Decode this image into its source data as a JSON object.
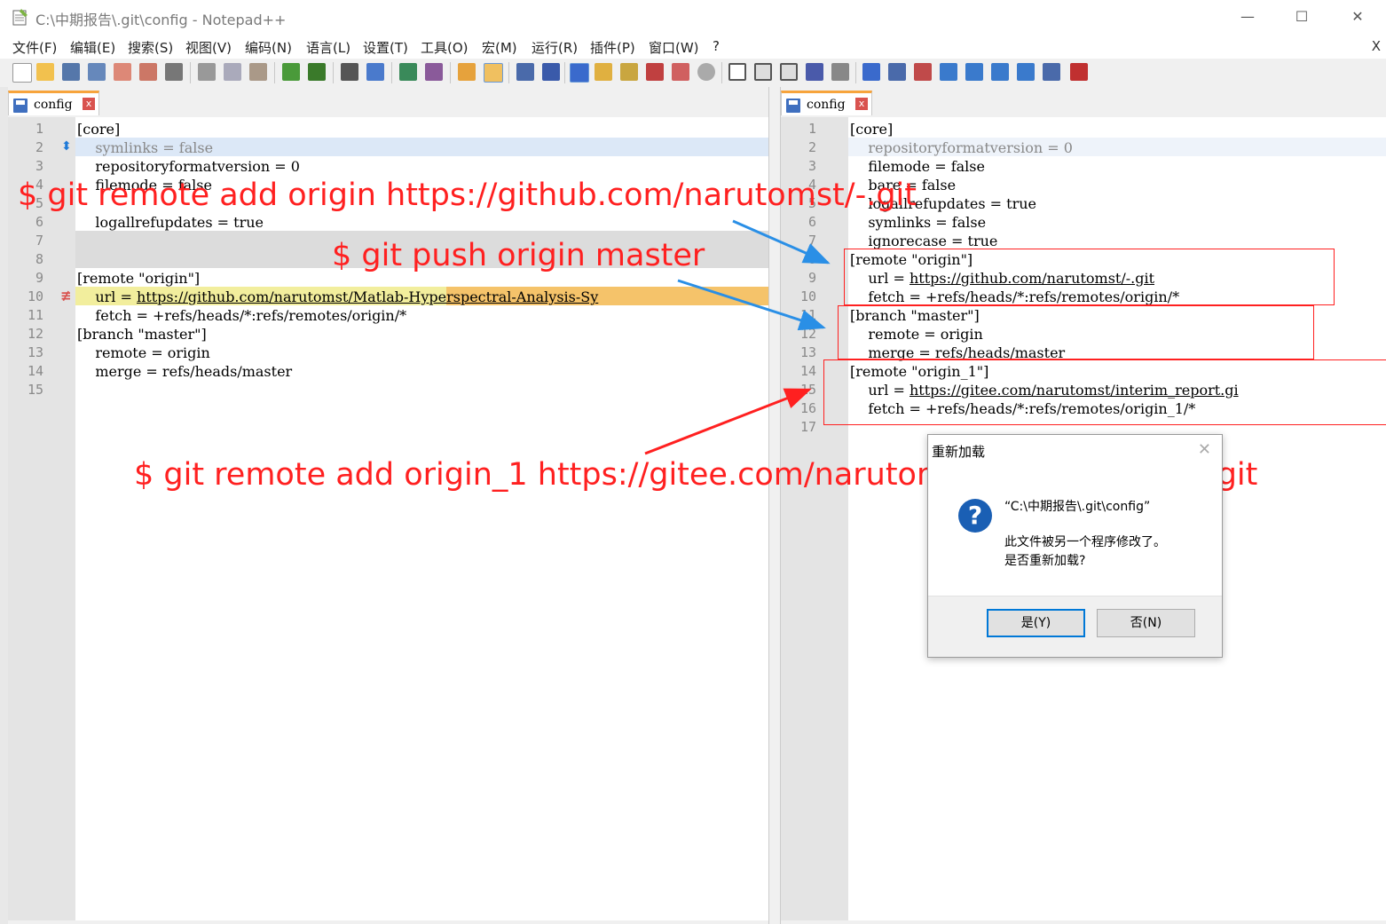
{
  "window": {
    "title": "C:\\中期报告\\.git\\config - Notepad++",
    "minimize": "—",
    "maximize": "☐",
    "close": "✕"
  },
  "menu": [
    "文件(F)",
    "编辑(E)",
    "搜索(S)",
    "视图(V)",
    "编码(N)",
    "语言(L)",
    "设置(T)",
    "工具(O)",
    "宏(M)",
    "运行(R)",
    "插件(P)",
    "窗口(W)",
    "?"
  ],
  "menu_close": "X",
  "left_tab": {
    "label": "config",
    "close": "x"
  },
  "right_tab": {
    "label": "config",
    "close": "x"
  },
  "left_lines": [
    {
      "n": "1",
      "text": "[core]"
    },
    {
      "n": "2",
      "text": "    symlinks = false"
    },
    {
      "n": "3",
      "text": "    repositoryformatversion = 0"
    },
    {
      "n": "4",
      "text": "    filemode = false"
    },
    {
      "n": "5",
      "text": ""
    },
    {
      "n": "6",
      "text": "    logallrefupdates = true"
    },
    {
      "n": "7",
      "text": ""
    },
    {
      "n": "8",
      "text": ""
    },
    {
      "n": "9",
      "text": "[remote \"origin\"]"
    },
    {
      "n": "10",
      "text": "    url = "
    },
    {
      "n": "11",
      "text": "    fetch = +refs/heads/*:refs/remotes/origin/*"
    },
    {
      "n": "12",
      "text": "[branch \"master\"]"
    },
    {
      "n": "13",
      "text": "    remote = origin"
    },
    {
      "n": "14",
      "text": "    merge = refs/heads/master"
    },
    {
      "n": "15",
      "text": ""
    }
  ],
  "left_url": {
    "part1": "https://github.com/narutomst",
    "part2": "/Matlab-Hyperspectral-Analysis-Sy"
  },
  "right_lines": [
    {
      "n": "1",
      "text": "[core]"
    },
    {
      "n": "2",
      "text": "    repositoryformatversion = 0"
    },
    {
      "n": "3",
      "text": "    filemode = false"
    },
    {
      "n": "4",
      "text": "    bare = false"
    },
    {
      "n": "5",
      "text": "    logallrefupdates = true"
    },
    {
      "n": "6",
      "text": "    symlinks = false"
    },
    {
      "n": "7",
      "text": "    ignorecase = true"
    },
    {
      "n": "8",
      "text": "[remote \"origin\"]"
    },
    {
      "n": "9",
      "text": "    url = "
    },
    {
      "n": "10",
      "text": "    fetch = +refs/heads/*:refs/remotes/origin/*"
    },
    {
      "n": "11",
      "text": "[branch \"master\"]"
    },
    {
      "n": "12",
      "text": "    remote = origin"
    },
    {
      "n": "13",
      "text": "    merge = refs/heads/master"
    },
    {
      "n": "14",
      "text": "[remote \"origin_1\"]"
    },
    {
      "n": "15",
      "text": "    url = "
    },
    {
      "n": "16",
      "text": "    fetch = +refs/heads/*:refs/remotes/origin_1/*"
    },
    {
      "n": "17",
      "text": ""
    }
  ],
  "right_url_9": "https://github.com/narutomst/-.git",
  "right_url_15": "https://gitee.com/narutomst/interim_report.gi",
  "annotations": {
    "cmd1": "$ git remote add origin https://github.com/narutomst/-.git",
    "cmd2": "$ git push origin master",
    "cmd3": "$ git remote add origin_1 https://gitee.com/narutomst/interim_report.git"
  },
  "annotation_color": "#ff2020",
  "dialog": {
    "title": "重新加载",
    "close": "✕",
    "path": "“C:\\中期报告\\.git\\config”",
    "line1": "此文件被另一个程序修改了。",
    "line2": "是否重新加载?",
    "yes": "是(Y)",
    "no": "否(N)"
  }
}
